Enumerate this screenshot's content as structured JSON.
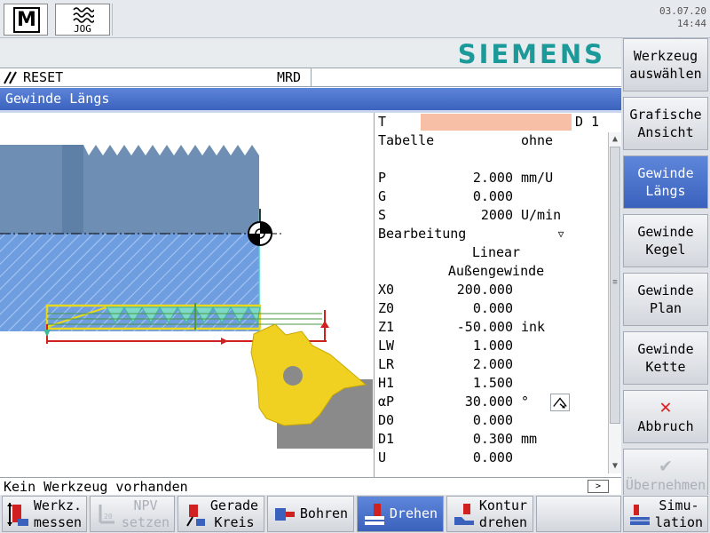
{
  "topbar": {
    "mode_letter": "M",
    "mode_label": "JOG",
    "date": "03.07.20",
    "time": "14:44"
  },
  "logo": "SIEMENS",
  "status": {
    "reset": "RESET",
    "mrd": "MRD"
  },
  "title": "Gewinde Längs",
  "params": {
    "T": {
      "label": "T",
      "value": "",
      "d_label": "D 1"
    },
    "tabelle": {
      "label": "Tabelle",
      "value": "ohne"
    },
    "rows": [
      {
        "label": "P",
        "value": "2.000",
        "unit": "mm/U"
      },
      {
        "label": "G",
        "value": "0.000",
        "unit": ""
      },
      {
        "label": "S",
        "value": "2000",
        "unit": "U/min"
      }
    ],
    "bearbeitung": {
      "label": "Bearbeitung",
      "dropdown": "▽"
    },
    "linear": "Linear",
    "aussengewinde": "Außengewinde",
    "rows2": [
      {
        "label": "X0",
        "value": "200.000",
        "unit": ""
      },
      {
        "label": "Z0",
        "value": "0.000",
        "unit": ""
      },
      {
        "label": "Z1",
        "value": "-50.000",
        "unit": "ink"
      },
      {
        "label": "LW",
        "value": "1.000",
        "unit": ""
      },
      {
        "label": "LR",
        "value": "2.000",
        "unit": ""
      },
      {
        "label": "H1",
        "value": "1.500",
        "unit": ""
      },
      {
        "label": "αP",
        "value": "30.000",
        "unit": "°"
      },
      {
        "label": "D0",
        "value": "0.000",
        "unit": ""
      },
      {
        "label": "D1",
        "value": "0.300",
        "unit": "mm"
      },
      {
        "label": "U",
        "value": "0.000",
        "unit": ""
      }
    ]
  },
  "message": "Kein Werkzeug vorhanden",
  "message_more": ">",
  "vsoftkeys": [
    {
      "line1": "Werkzeug",
      "line2": "auswählen"
    },
    {
      "line1": "Grafische",
      "line2": "Ansicht"
    },
    {
      "line1": "Gewinde",
      "line2": "Längs"
    },
    {
      "line1": "Gewinde",
      "line2": "Kegel"
    },
    {
      "line1": "Gewinde",
      "line2": "Plan"
    },
    {
      "line1": "Gewinde",
      "line2": "Kette"
    },
    {
      "symbol": "✕",
      "line1": "Abbruch"
    },
    {
      "symbol": "✔",
      "line1": "Übernehmen"
    }
  ],
  "hsoftkeys": [
    {
      "line1": "Werkz.",
      "line2": "messen"
    },
    {
      "line1": "NPV",
      "line2": "setzen",
      "icon_text": "20"
    },
    {
      "line1": "Gerade",
      "line2": "Kreis"
    },
    {
      "line1": "Bohren"
    },
    {
      "line1": "Drehen"
    },
    {
      "line1": "Kontur",
      "line2": "drehen"
    },
    {
      "line1": ""
    },
    {
      "line1": "Simu-",
      "line2": "lation"
    }
  ],
  "colors": {
    "accent": "#3b63be",
    "logo": "#1c9a9a",
    "tool": "#f0d020",
    "workpiece": "#6f8eb3",
    "tool_field": "#f7c0a6",
    "cancel": "#e02020"
  }
}
